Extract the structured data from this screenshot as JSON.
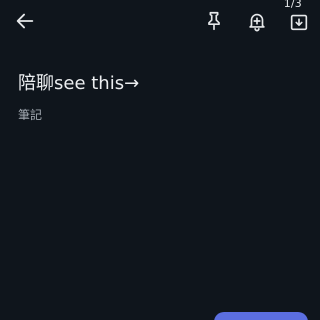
{
  "toolbar": {
    "back_icon": "arrow-left-icon",
    "pin_icon": "pin-icon",
    "reminder_icon": "bell-plus-icon",
    "archive_icon": "archive-icon"
  },
  "page_counter": "1/3",
  "note": {
    "title": "陪聊see this→",
    "label": "筆記"
  },
  "colors": {
    "background": "#0f151c",
    "text": "#e6e8ea",
    "secondary_text": "#a3aab2",
    "accent": "#5b6ee0"
  }
}
